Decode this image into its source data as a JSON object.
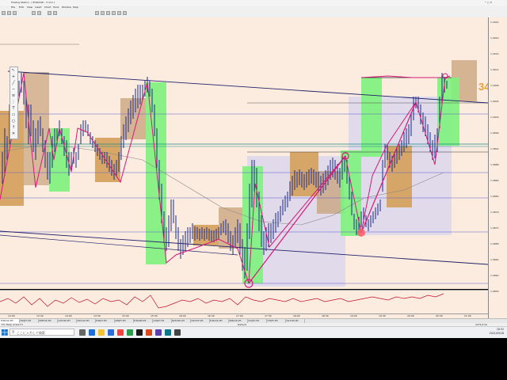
{
  "window": {
    "title": "Trading Station - [ EUR/USD , 5 min ]",
    "menu": [
      "File",
      "Edit",
      "View",
      "Insert",
      "Chart",
      "Tools",
      "Window",
      "Help"
    ]
  },
  "counter": "34",
  "price_axis": [
    "1.0924",
    "1.0920",
    "1.0916",
    "1.0912",
    "1.0908",
    "1.0904",
    "1.0900",
    "1.0896",
    "1.0892",
    "1.0888",
    "1.0884",
    "1.0880",
    "1.0876",
    "1.0872",
    "1.0868",
    "1.0864",
    "1.0860",
    "1.0856"
  ],
  "time_axis": [
    "13:00",
    "13:30",
    "14:00",
    "14:30",
    "15:00",
    "15:30",
    "16:00",
    "16:30",
    "17:00",
    "17:30",
    "18:00",
    "18:30",
    "19:00",
    "19:30",
    "20:00",
    "20:30",
    "21:00"
  ],
  "symbol_tabs": [
    "EURUSD,M5",
    "USDJPY,M5",
    "GBPUSD,M5",
    "AUDUSD,M5",
    "USDCAD,M5",
    "EURJPY,M5",
    "GBPJPY,M5",
    "EURGBP,M5",
    "AUDJPY,M5",
    "NZDUSD,M5",
    "USDCHF,M5",
    "EURAUD,M5",
    "GBPAUD,M5",
    "CADJPY,M5",
    "CHFJPY,M5",
    "XAUUSD,M5"
  ],
  "status": {
    "left": "For Help, press F1",
    "center": "Default",
    "right": "2471/2 kb"
  },
  "taskbar": {
    "search_placeholder": "ここに入力して検索",
    "time": "16:32",
    "date": "2021/05/18"
  },
  "colors": {
    "chart_bg": "#fcecdf",
    "bull_zone": "#7df27d",
    "supply_zone": "#d4a05a",
    "range_box": "#c9ccf2",
    "zigzag": "#d6197a",
    "counter": "#e8a030"
  }
}
